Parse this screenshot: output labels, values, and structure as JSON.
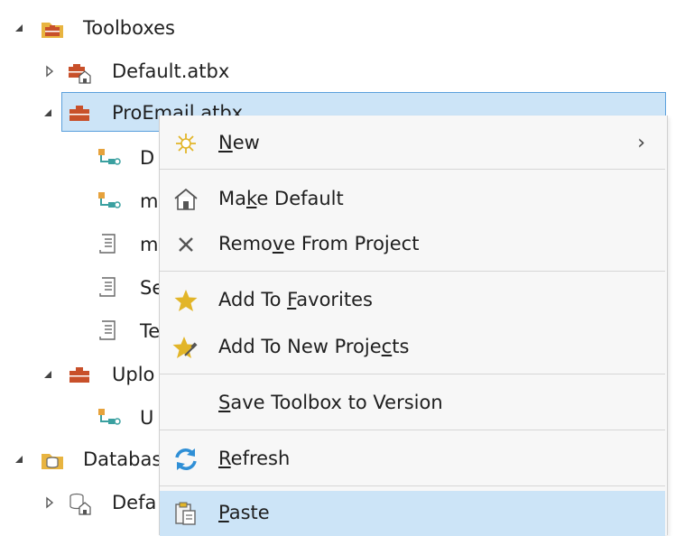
{
  "tree": {
    "toolboxes_label": "Toolboxes",
    "default_atbx_label": "Default.atbx",
    "proemail_atbx_label": "ProEmail.atbx",
    "children_partial": [
      "D",
      "m",
      "m",
      "Se",
      "Te"
    ],
    "upload_partial": "Uplo",
    "upload_child_partial": "U",
    "databases_partial": "Databas",
    "default_db_partial": "Defa"
  },
  "menu": {
    "items": [
      {
        "pre": "",
        "key": "N",
        "post": "ew",
        "icon": "new-sparkle-icon",
        "submenu": true
      },
      {
        "pre": "Ma",
        "key": "k",
        "post": "e Default",
        "icon": "home-icon"
      },
      {
        "pre": "Remo",
        "key": "v",
        "post": "e From Project",
        "icon": "close-x-icon"
      },
      {
        "pre": "Add To ",
        "key": "F",
        "post": "avorites",
        "icon": "star-icon"
      },
      {
        "pre": "Add To New Proje",
        "key": "c",
        "post": "ts",
        "icon": "star-pin-icon"
      },
      {
        "pre": "",
        "key": "S",
        "post": "ave Toolbox to Version",
        "icon": ""
      },
      {
        "pre": "",
        "key": "R",
        "post": "efresh",
        "icon": "refresh-icon"
      },
      {
        "pre": "",
        "key": "P",
        "post": "aste",
        "icon": "paste-icon"
      }
    ],
    "submenu_chevron": "›"
  },
  "colors": {
    "selection_bg": "#cce4f7",
    "selection_border": "#5aa0dc",
    "toolbox_red": "#c8502a",
    "folder_yellow": "#e8b440",
    "star_gold": "#e2b528",
    "refresh_blue": "#2f8fd6",
    "model_orange": "#e6a23c",
    "model_teal": "#3aa0a0"
  }
}
